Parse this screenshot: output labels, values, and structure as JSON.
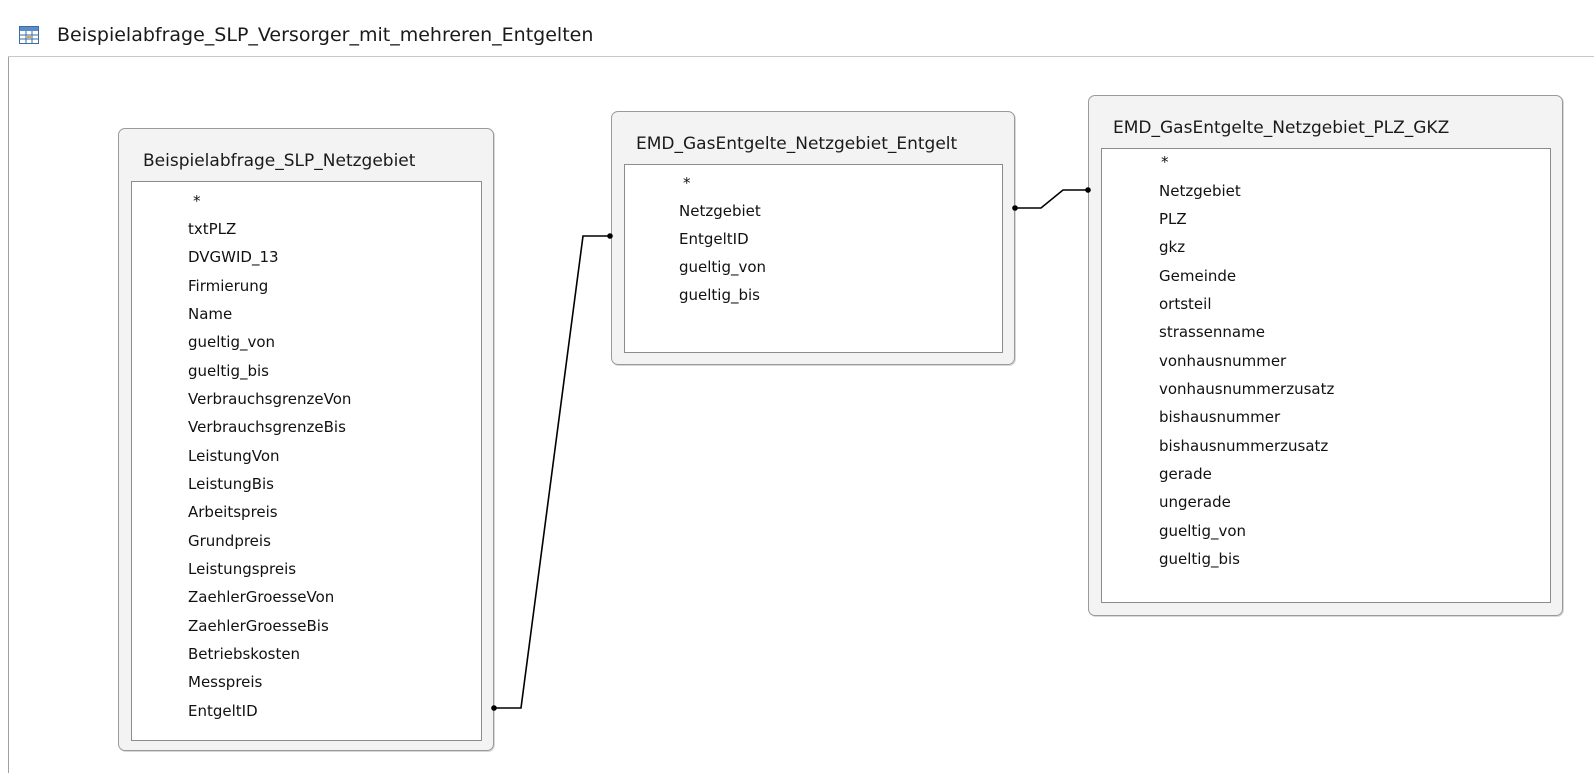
{
  "window": {
    "title": "Beispielabfrage_SLP_Versorger_mit_mehreren_Entgelten",
    "icon": "query-icon"
  },
  "tables": [
    {
      "name": "Beispielabfrage_SLP_Netzgebiet",
      "fields": [
        "*",
        "txtPLZ",
        "DVGWID_13",
        "Firmierung",
        "Name",
        "gueltig_von",
        "gueltig_bis",
        "VerbrauchsgrenzeVon",
        "VerbrauchsgrenzeBis",
        "LeistungVon",
        "LeistungBis",
        "Arbeitspreis",
        "Grundpreis",
        "Leistungspreis",
        "ZaehlerGroesseVon",
        "ZaehlerGroesseBis",
        "Betriebskosten",
        "Messpreis",
        "EntgeltID"
      ]
    },
    {
      "name": "EMD_GasEntgelte_Netzgebiet_Entgelt",
      "fields": [
        "*",
        "Netzgebiet",
        "EntgeltID",
        "gueltig_von",
        "gueltig_bis"
      ]
    },
    {
      "name": "EMD_GasEntgelte_Netzgebiet_PLZ_GKZ",
      "fields": [
        "*",
        "Netzgebiet",
        "PLZ",
        "gkz",
        "Gemeinde",
        "ortsteil",
        "strassenname",
        "vonhausnummer",
        "vonhausnummerzusatz",
        "bishausnummer",
        "bishausnummerzusatz",
        "gerade",
        "ungerade",
        "gueltig_von",
        "gueltig_bis"
      ]
    }
  ],
  "joins": [
    {
      "from_table": "Beispielabfrage_SLP_Netzgebiet",
      "from_field": "EntgeltID",
      "to_table": "EMD_GasEntgelte_Netzgebiet_Entgelt",
      "to_field": "EntgeltID"
    },
    {
      "from_table": "EMD_GasEntgelte_Netzgebiet_Entgelt",
      "from_field": "Netzgebiet",
      "to_table": "EMD_GasEntgelte_Netzgebiet_PLZ_GKZ",
      "to_field": "Netzgebiet"
    }
  ],
  "colors": {
    "box_border": "#9a9a9a",
    "box_background": "#f3f3f3",
    "line": "#000000"
  }
}
